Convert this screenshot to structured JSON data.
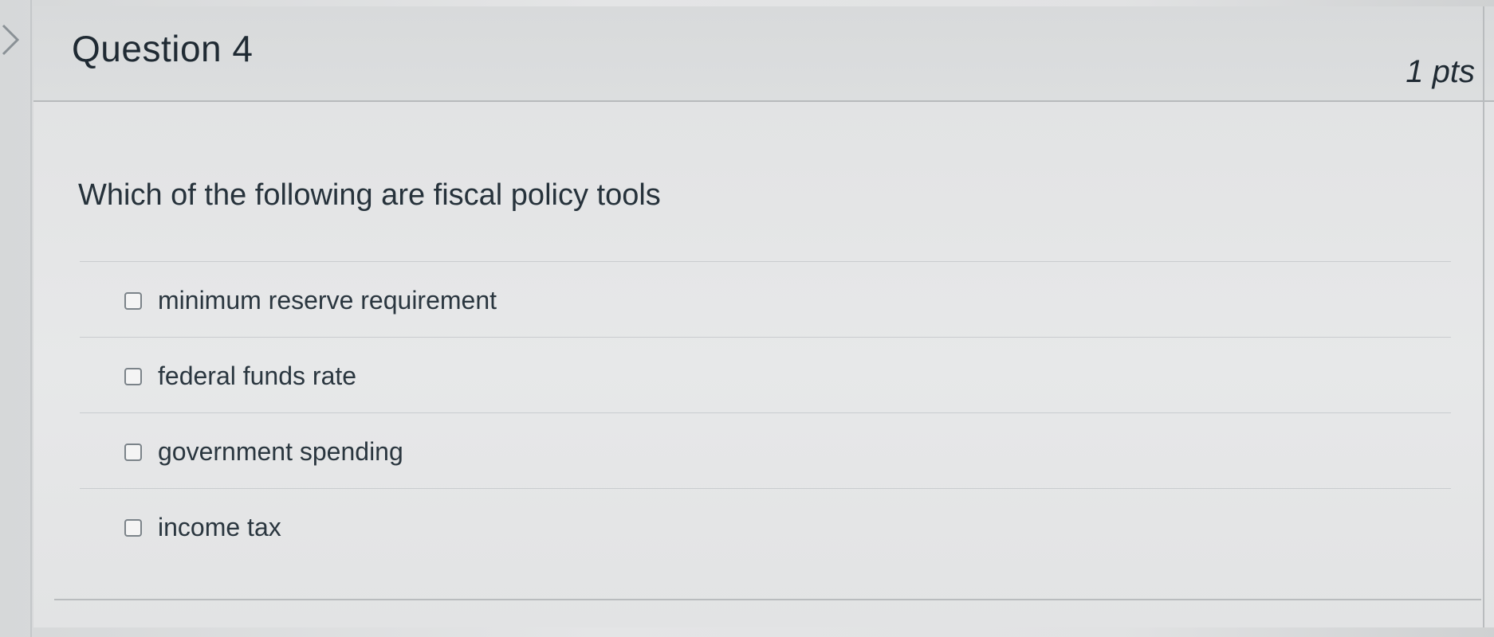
{
  "question": {
    "title": "Question 4",
    "points": "1 pts",
    "text": "Which of the following are fiscal policy tools"
  },
  "answers": [
    {
      "label": "minimum reserve requirement",
      "checked": false
    },
    {
      "label": "federal funds rate",
      "checked": false
    },
    {
      "label": "government spending",
      "checked": false
    },
    {
      "label": "income tax",
      "checked": false
    }
  ],
  "icons": {
    "nav": "chevron-right-icon",
    "checkbox": "checkbox-icon"
  },
  "colors": {
    "text": "#2d3b45",
    "border": "#b9bcbe",
    "checkbox_border": "#7b8389"
  }
}
